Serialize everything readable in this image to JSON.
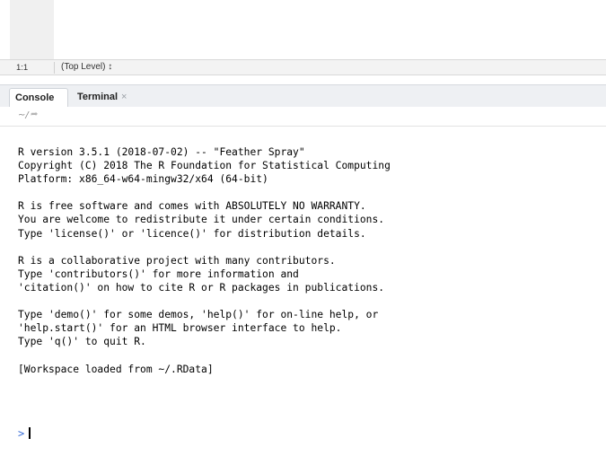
{
  "statusbar": {
    "position": "1:1",
    "scope": "(Top Level) ↕"
  },
  "tabs": [
    {
      "label": "Console"
    },
    {
      "label": "Terminal",
      "close": "×"
    }
  ],
  "console": {
    "path": "~/",
    "path_icon": "➦",
    "startup_lines": [
      "R version 3.5.1 (2018-07-02) -- \"Feather Spray\"",
      "Copyright (C) 2018 The R Foundation for Statistical Computing",
      "Platform: x86_64-w64-mingw32/x64 (64-bit)",
      "",
      "R is free software and comes with ABSOLUTELY NO WARRANTY.",
      "You are welcome to redistribute it under certain conditions.",
      "Type 'license()' or 'licence()' for distribution details.",
      "",
      "R is a collaborative project with many contributors.",
      "Type 'contributors()' for more information and",
      "'citation()' on how to cite R or R packages in publications.",
      "",
      "Type 'demo()' for some demos, 'help()' for on-line help, or",
      "'help.start()' for an HTML browser interface to help.",
      "Type 'q()' to quit R.",
      "",
      "[Workspace loaded from ~/.RData]"
    ],
    "prompt": ">"
  }
}
